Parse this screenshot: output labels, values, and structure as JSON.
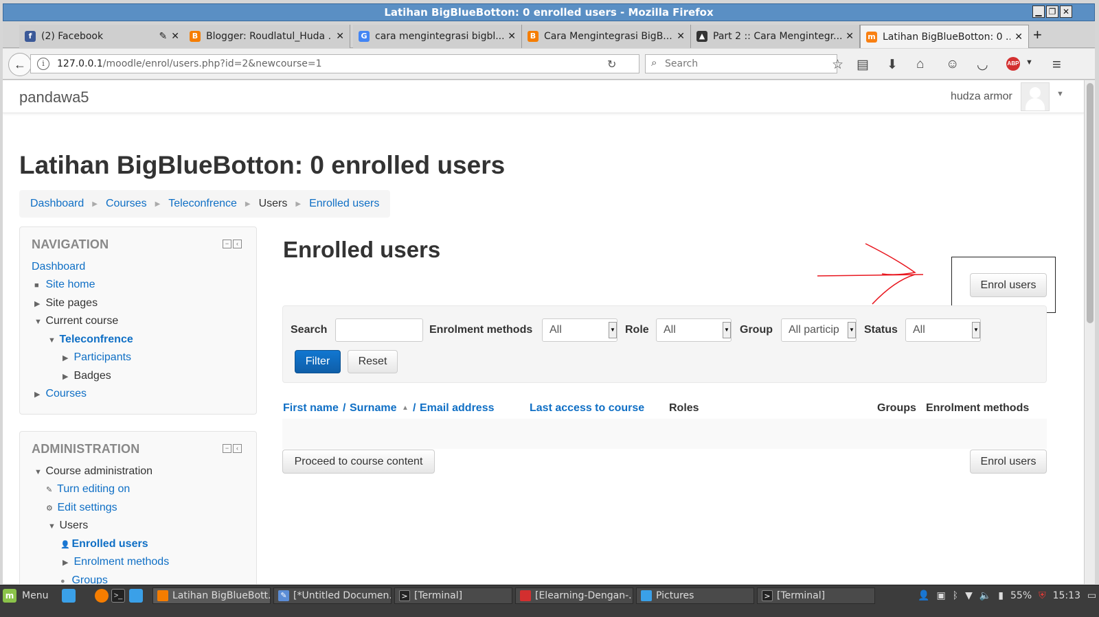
{
  "window": {
    "title": "Latihan BigBlueBotton: 0 enrolled users - Mozilla Firefox"
  },
  "tabs": [
    {
      "label": "(2) Facebook",
      "icon": "facebook-icon",
      "color": "#3b5998"
    },
    {
      "label": "Blogger: Roudlatul_Huda ...",
      "icon": "blogger-icon",
      "color": "#f57d00"
    },
    {
      "label": "cara mengintegrasi bigbl...",
      "icon": "google-icon",
      "color": "#4285f4"
    },
    {
      "label": "Cara Mengintegrasi BigB...",
      "icon": "blogger-icon",
      "color": "#f57d00"
    },
    {
      "label": "Part 2 :: Cara Mengintegr...",
      "icon": "tux-icon",
      "color": "#333333"
    },
    {
      "label": "Latihan BigBlueBotton: 0 ...",
      "icon": "moodle-icon",
      "color": "#f98012"
    }
  ],
  "navbar": {
    "url_host": "127.0.0.1",
    "url_path": "/moodle/enrol/users.php?id=2&newcourse=1",
    "search_placeholder": "Search"
  },
  "site": {
    "name": "pandawa5",
    "user": "hudza armor"
  },
  "page": {
    "title": "Latihan BigBlueBotton: 0 enrolled users",
    "breadcrumb": [
      "Dashboard",
      "Courses",
      "Teleconfrence",
      "Users",
      "Enrolled users"
    ],
    "heading": "Enrolled users"
  },
  "navigation": {
    "title": "NAVIGATION",
    "items": [
      "Dashboard",
      "Site home",
      "Site pages",
      "Current course",
      "Teleconfrence",
      "Participants",
      "Badges",
      "Courses"
    ]
  },
  "administration": {
    "title": "ADMINISTRATION",
    "items": [
      "Course administration",
      "Turn editing on",
      "Edit settings",
      "Users",
      "Enrolled users",
      "Enrolment methods",
      "Groups"
    ]
  },
  "filters": {
    "search_label": "Search",
    "enrolment_label": "Enrolment methods",
    "enrolment_value": "All",
    "role_label": "Role",
    "role_value": "All",
    "group_label": "Group",
    "group_value": "All particip",
    "status_label": "Status",
    "status_value": "All",
    "filter_button": "Filter",
    "reset_button": "Reset"
  },
  "table": {
    "col_firstname": "First name",
    "col_slash1": "/",
    "col_surname": "Surname",
    "col_slash2": "/",
    "col_email": "Email address",
    "col_lastaccess": "Last access to course",
    "col_roles": "Roles",
    "col_groups": "Groups",
    "col_enrolment": "Enrolment methods"
  },
  "buttons": {
    "enrol_users": "Enrol users",
    "proceed": "Proceed to course content"
  },
  "taskbar": {
    "menu": "Menu",
    "windows": [
      "Latihan BigBlueBott...",
      "[*Untitled Documen...",
      "[Terminal]",
      "[Elearning-Dengan-...",
      "Pictures",
      "[Terminal]"
    ],
    "battery": "55%",
    "clock": "15:13"
  }
}
